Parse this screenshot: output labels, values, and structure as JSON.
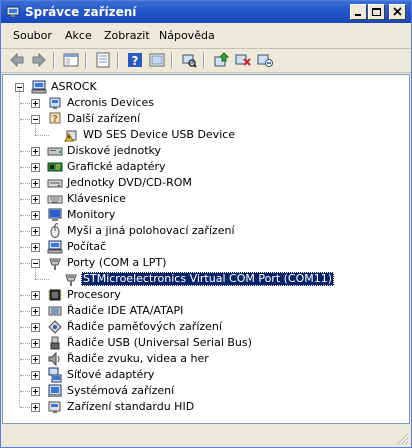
{
  "window": {
    "title": "Správce zařízení"
  },
  "menu": [
    "Soubor",
    "Akce",
    "Zobrazit",
    "Nápověda"
  ],
  "toolbar": {
    "icons": [
      "back-arrow-icon",
      "forward-arrow-icon",
      "show-hide-tree-icon",
      "properties-icon",
      "help-icon",
      "view-icon",
      "scan-hardware-icon",
      "update-driver-icon",
      "uninstall-icon",
      "disable-icon"
    ]
  },
  "tree": {
    "root": "ASROCK",
    "items": [
      {
        "label": "Acronis Devices",
        "icon": "device-icon",
        "expanded": false
      },
      {
        "label": "Další zařízení",
        "icon": "unknown-device-icon",
        "expanded": true
      },
      {
        "label": "WD SES Device USB Device",
        "icon": "warning-device-icon",
        "child": true
      },
      {
        "label": "Diskové jednotky",
        "icon": "disk-icon",
        "expanded": false
      },
      {
        "label": "Grafické adaptéry",
        "icon": "display-adapter-icon",
        "expanded": false
      },
      {
        "label": "Jednotky DVD/CD-ROM",
        "icon": "cdrom-icon",
        "expanded": false
      },
      {
        "label": "Klávesnice",
        "icon": "keyboard-icon",
        "expanded": false
      },
      {
        "label": "Monitory",
        "icon": "monitor-icon",
        "expanded": false
      },
      {
        "label": "Myši a jiná polohovací zařízení",
        "icon": "mouse-icon",
        "expanded": false
      },
      {
        "label": "Počítač",
        "icon": "computer-icon",
        "expanded": false
      },
      {
        "label": "Porty (COM a LPT)",
        "icon": "port-icon",
        "expanded": true
      },
      {
        "label": "STMicroelectronics Virtual COM Port (COM11)",
        "icon": "port-icon",
        "child": true,
        "selected": true
      },
      {
        "label": "Procesory",
        "icon": "processor-icon",
        "expanded": false
      },
      {
        "label": "Řadiče IDE ATA/ATAPI",
        "icon": "ide-controller-icon",
        "expanded": false
      },
      {
        "label": "Řadiče paměťových zařízení",
        "icon": "storage-controller-icon",
        "expanded": false
      },
      {
        "label": "Řadiče USB (Universal Serial Bus)",
        "icon": "usb-icon",
        "expanded": false
      },
      {
        "label": "Řadiče zvuku, videa a her",
        "icon": "sound-icon",
        "expanded": false
      },
      {
        "label": "Síťové adaptéry",
        "icon": "network-icon",
        "expanded": false
      },
      {
        "label": "Systémová zařízení",
        "icon": "system-device-icon",
        "expanded": false
      },
      {
        "label": "Zařízení standardu HID",
        "icon": "hid-icon",
        "expanded": false
      }
    ]
  },
  "colors": {
    "titlebar": "#2456c8",
    "selection": "#0a246a",
    "chrome": "#ece9d8"
  }
}
